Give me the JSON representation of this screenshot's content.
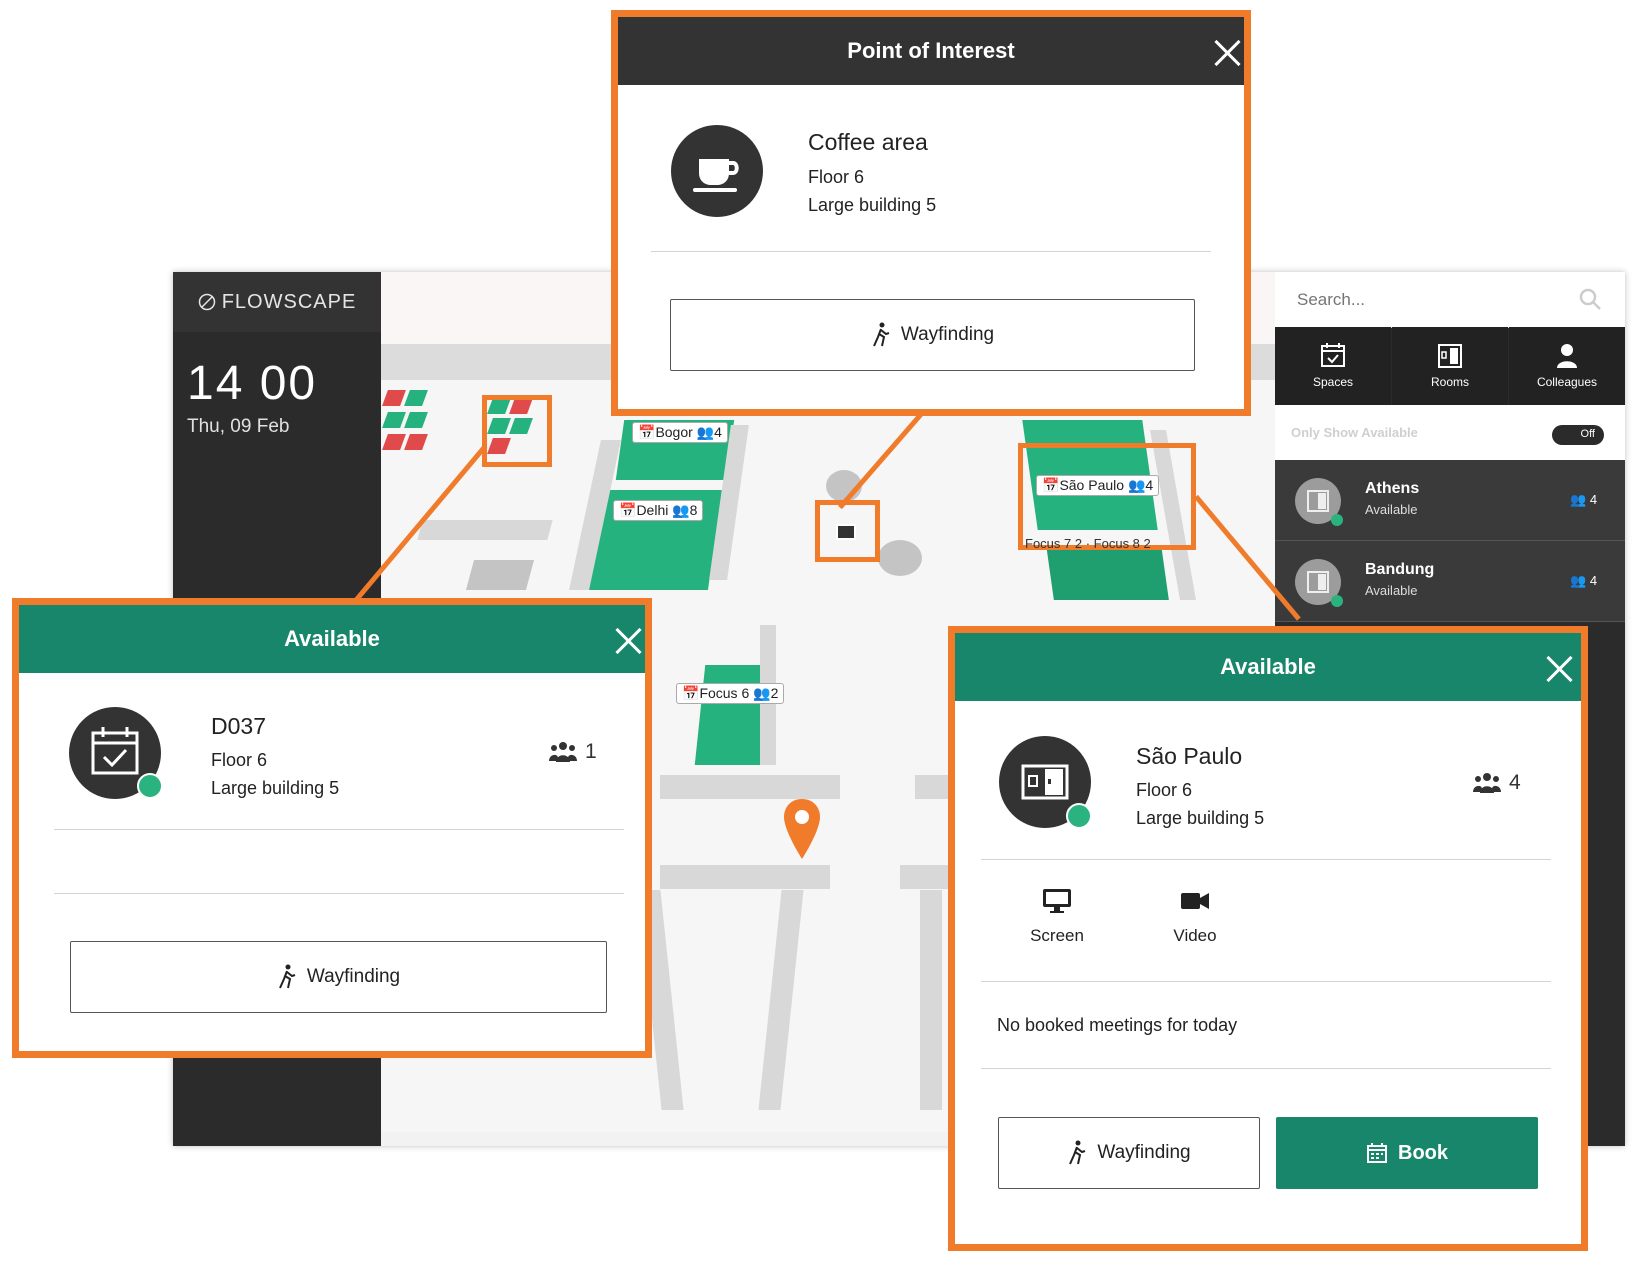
{
  "app": {
    "logo": "FLOWSCAPE",
    "clock_time": "14 00",
    "clock_date": "Thu, 09 Feb"
  },
  "search": {
    "placeholder": "Search..."
  },
  "categories": [
    {
      "label": "Spaces",
      "icon": "calendar-check-icon"
    },
    {
      "label": "Rooms",
      "icon": "door-icon"
    },
    {
      "label": "Colleagues",
      "icon": "person-icon"
    }
  ],
  "filter": {
    "label": "Only Show Available",
    "toggle": "Off"
  },
  "rooms": [
    {
      "name": "Athens",
      "status": "Available",
      "capacity": "4"
    },
    {
      "name": "Bandung",
      "status": "Available",
      "capacity": "4"
    }
  ],
  "map_labels": {
    "bogor": "Bogor",
    "bogor_cap": "4",
    "delhi": "Delhi",
    "delhi_cap": "8",
    "sao_paulo": "São Paulo",
    "sao_paulo_cap": "4",
    "focus6": "Focus 6",
    "focus6_cap": "2",
    "focus7": "Focus 7",
    "focus7_cap": "2",
    "focus8": "Focus 8",
    "focus8_cap": "2"
  },
  "poi_popup": {
    "header": "Point of Interest",
    "title": "Coffee area",
    "floor": "Floor 6",
    "building": "Large building 5",
    "wayfinding": "Wayfinding",
    "icon": "coffee-cup-icon"
  },
  "desk_popup": {
    "header": "Available",
    "title": "D037",
    "floor": "Floor 6",
    "building": "Large building 5",
    "capacity": "1",
    "wayfinding": "Wayfinding",
    "icon": "calendar-check-icon"
  },
  "room_popup": {
    "header": "Available",
    "title": "São Paulo",
    "floor": "Floor 6",
    "building": "Large building 5",
    "capacity": "4",
    "facilities": [
      {
        "label": "Screen",
        "icon": "monitor-icon"
      },
      {
        "label": "Video",
        "icon": "video-camera-icon"
      }
    ],
    "meetings": "No booked meetings for today",
    "wayfinding": "Wayfinding",
    "book": "Book"
  },
  "colors": {
    "accent_orange": "#f07b2b",
    "available_green": "#17866a",
    "status_dot": "#2bb37f",
    "dark_header": "#333333"
  }
}
